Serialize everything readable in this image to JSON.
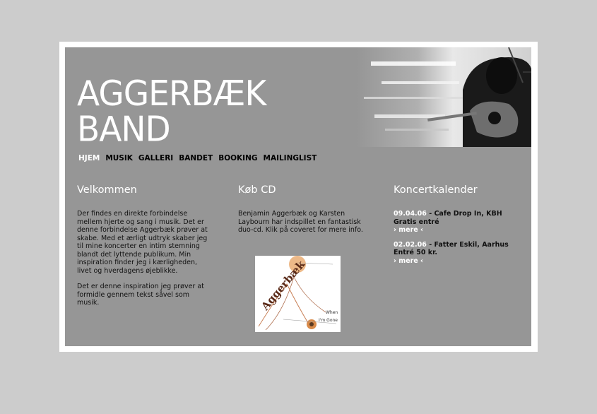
{
  "site": {
    "title_line1": "AGGERBÆK",
    "title_line2": "BAND"
  },
  "nav": {
    "items": [
      "HJEM",
      "MUSIK",
      "GALLERI",
      "BANDET",
      "BOOKING",
      "MAILINGLIST"
    ],
    "active": "HJEM"
  },
  "welcome": {
    "heading": "Velkommen",
    "para1": "Der findes en direkte forbindelse mellem hjerte og sang i musik. Det er denne forbindelse Aggerbæk prøver at skabe. Med et ærligt udtryk skaber jeg til mine koncerter en intim stemning blandt det lyttende publikum. Min inspiration finder jeg i kærligheden, livet og hverdagens øjeblikke.",
    "para2": "Det er denne inspiration jeg prøver at formidle gennem tekst såvel som musik."
  },
  "cd": {
    "heading": "Køb CD",
    "text": "Benjamin Aggerbæk og Karsten Laybourn har indspillet en fantastisk duo-cd. Klik på coveret for mere info.",
    "cover_word": "Aggerbæk",
    "cover_line1": "When",
    "cover_line2": "I'm Gone"
  },
  "calendar": {
    "heading": "Koncertkalender",
    "events": [
      {
        "date": "09.04.06",
        "title": " - Cafe Drop In, KBH",
        "note": "Gratis entré",
        "more": "› mere ‹"
      },
      {
        "date": "02.02.06",
        "title": " - Fatter Eskil, Aarhus",
        "note": "Entré 50 kr.",
        "more": "› mere ‹"
      }
    ]
  },
  "colors": {
    "page_bg": "#cccccc",
    "frame": "#ffffff",
    "panel": "#969696",
    "accent_text": "#ffffff"
  }
}
